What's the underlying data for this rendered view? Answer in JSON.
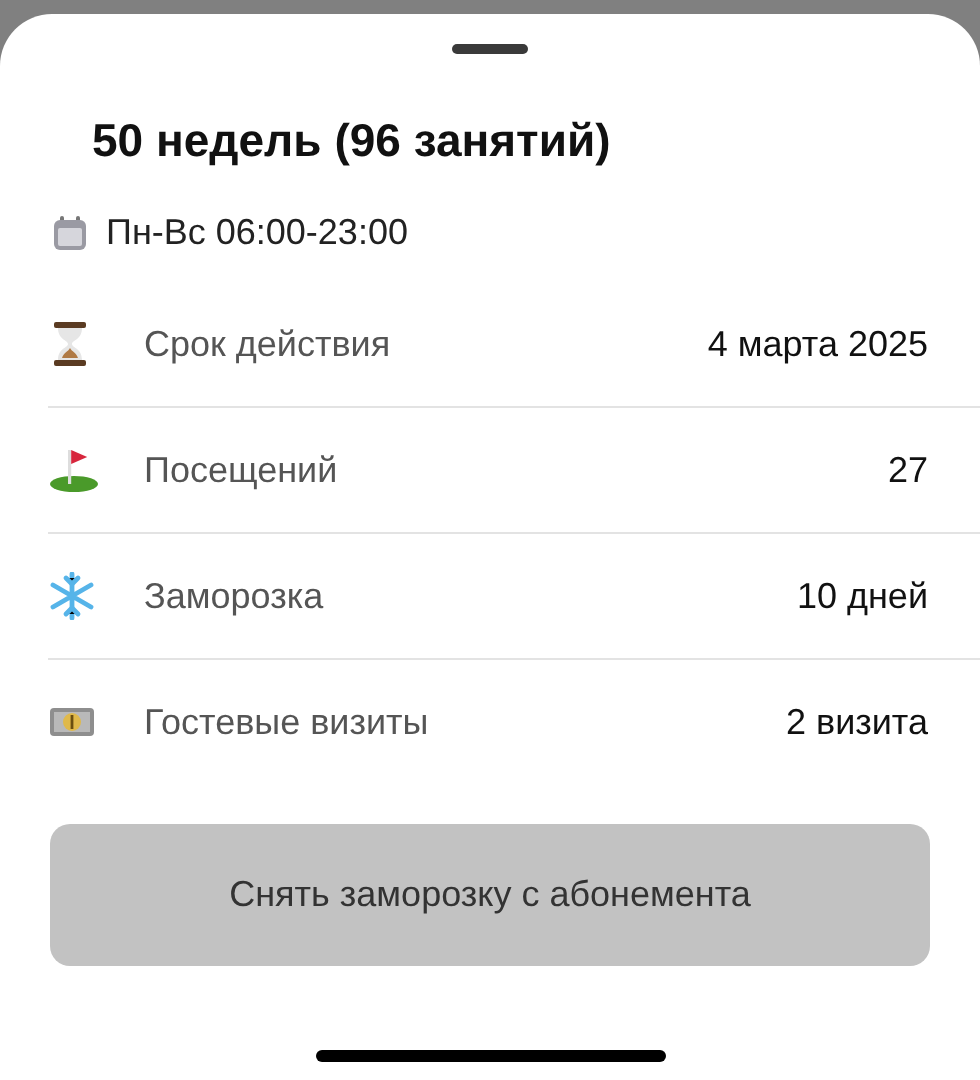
{
  "sheet": {
    "title": "50 недель (96 занятий)",
    "schedule": "Пн-Вс 06:00-23:00",
    "rows": [
      {
        "label": "Срок действия",
        "value": "4 марта 2025"
      },
      {
        "label": "Посещений",
        "value": "27"
      },
      {
        "label": "Заморозка",
        "value": "10 дней"
      },
      {
        "label": "Гостевые визиты",
        "value": "2 визита"
      }
    ],
    "button": "Снять заморозку с абонемента"
  }
}
